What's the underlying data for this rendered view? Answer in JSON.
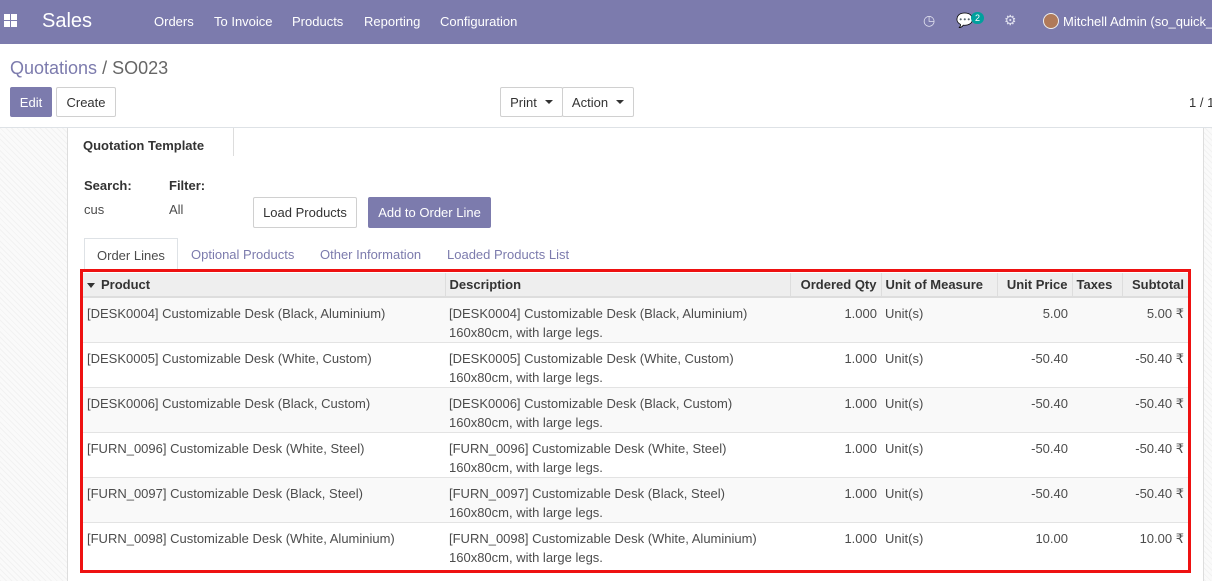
{
  "navbar": {
    "app_name": "Sales",
    "menu": [
      "Orders",
      "To Invoice",
      "Products",
      "Reporting",
      "Configuration"
    ],
    "messages_count": "2",
    "user": "Mitchell Admin (so_quick_"
  },
  "breadcrumb": {
    "parent": "Quotations",
    "separator": "/",
    "current": "SO023"
  },
  "buttons": {
    "edit": "Edit",
    "create": "Create",
    "print": "Print",
    "action": "Action",
    "load_products": "Load Products",
    "add_to_order_line": "Add to Order Line"
  },
  "pager": "1 / 1",
  "form": {
    "quotation_template_label": "Quotation Template",
    "search_label": "Search:",
    "search_value": "cus",
    "filter_label": "Filter:",
    "filter_value": "All"
  },
  "tabs": [
    "Order Lines",
    "Optional Products",
    "Other Information",
    "Loaded Products List"
  ],
  "table": {
    "headers": [
      "Product",
      "Description",
      "Ordered Qty",
      "Unit of Measure",
      "Unit Price",
      "Taxes",
      "Subtotal"
    ],
    "rows": [
      {
        "product": "[DESK0004] Customizable Desk (Black, Aluminium)",
        "desc1": "[DESK0004] Customizable Desk (Black, Aluminium)",
        "desc2": "160x80cm, with large legs.",
        "qty": "1.000",
        "uom": "Unit(s)",
        "price": "5.00",
        "taxes": "",
        "subtotal": "5.00 ₹"
      },
      {
        "product": "[DESK0005] Customizable Desk (White, Custom)",
        "desc1": "[DESK0005] Customizable Desk (White, Custom)",
        "desc2": "160x80cm, with large legs.",
        "qty": "1.000",
        "uom": "Unit(s)",
        "price": "-50.40",
        "taxes": "",
        "subtotal": "-50.40 ₹"
      },
      {
        "product": "[DESK0006] Customizable Desk (Black, Custom)",
        "desc1": "[DESK0006] Customizable Desk (Black, Custom)",
        "desc2": "160x80cm, with large legs.",
        "qty": "1.000",
        "uom": "Unit(s)",
        "price": "-50.40",
        "taxes": "",
        "subtotal": "-50.40 ₹"
      },
      {
        "product": "[FURN_0096] Customizable Desk (White, Steel)",
        "desc1": "[FURN_0096] Customizable Desk (White, Steel)",
        "desc2": "160x80cm, with large legs.",
        "qty": "1.000",
        "uom": "Unit(s)",
        "price": "-50.40",
        "taxes": "",
        "subtotal": "-50.40 ₹"
      },
      {
        "product": "[FURN_0097] Customizable Desk (Black, Steel)",
        "desc1": "[FURN_0097] Customizable Desk (Black, Steel)",
        "desc2": "160x80cm, with large legs.",
        "qty": "1.000",
        "uom": "Unit(s)",
        "price": "-50.40",
        "taxes": "",
        "subtotal": "-50.40 ₹"
      },
      {
        "product": "[FURN_0098] Customizable Desk (White, Aluminium)",
        "desc1": "[FURN_0098] Customizable Desk (White, Aluminium)",
        "desc2": "160x80cm, with large legs.",
        "qty": "1.000",
        "uom": "Unit(s)",
        "price": "10.00",
        "taxes": "",
        "subtotal": "10.00 ₹"
      }
    ]
  },
  "colors": {
    "brand": "#7c7bad",
    "highlight_border": "#ee1111",
    "badge": "#00a09d"
  },
  "icons": [
    "apps-icon",
    "clock-icon",
    "chat-icon",
    "bug-icon",
    "avatar",
    "sort-caret-icon",
    "dropdown-caret-icon"
  ]
}
